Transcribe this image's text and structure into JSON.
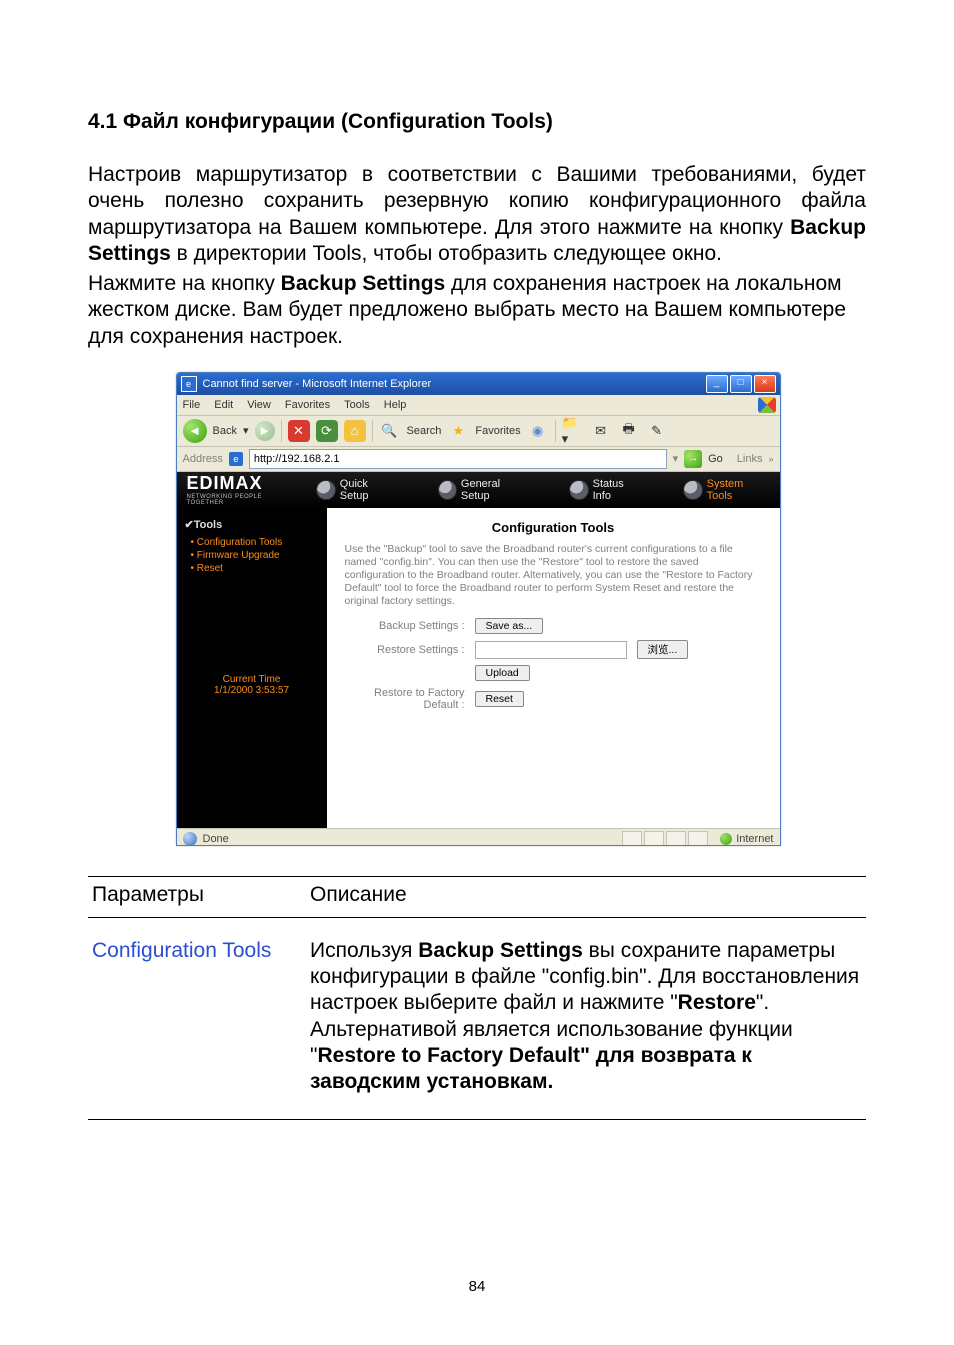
{
  "heading": "4.1 Файл конфигурации (Configuration Tools)",
  "para1_a": "Настроив маршрутизатор в соответствии с Вашими требованиями, будет очень полезно сохранить резервную копию конфигурационного файла маршрутизатора на Вашем компьютере. Для этого нажмите на кнопку ",
  "para1_b": "Backup Settings",
  "para1_c": " в директории Tools, чтобы отобразить следующее окно.",
  "para2_a": "Нажмите на кнопку ",
  "para2_b": "Backup Settings",
  "para2_c": " для сохранения настроек на локальном жестком диске. Вам будет предложено выбрать место на Вашем компьютере для сохранения настроек.",
  "browser": {
    "title": "Cannot find server - Microsoft Internet Explorer",
    "menu": {
      "file": "File",
      "edit": "Edit",
      "view": "View",
      "favorites": "Favorites",
      "tools": "Tools",
      "help": "Help"
    },
    "toolbar": {
      "back": "Back",
      "search": "Search",
      "favorites": "Favorites"
    },
    "addr_label": "Address",
    "addr_value": "http://192.168.2.1",
    "go_label": "Go",
    "links_label": "Links",
    "status_done": "Done",
    "status_zone": "Internet"
  },
  "router": {
    "brand": "EDIMAX",
    "brand_sub": "NETWORKING PEOPLE TOGETHER",
    "nav": {
      "quick": "Quick Setup",
      "general": "General Setup",
      "status": "Status Info",
      "system": "System Tools"
    },
    "side": {
      "section": "✔Tools",
      "items": [
        "Configuration Tools",
        "Firmware Upgrade",
        "Reset"
      ],
      "ct_label": "Current Time",
      "ct_value": "1/1/2000 3:53:57"
    },
    "page_title": "Configuration Tools",
    "blurb": "Use the \"Backup\" tool to save the Broadband router's current configurations to a file named \"config.bin\". You can then use the \"Restore\" tool to restore the saved configuration to the Broadband router. Alternatively, you can use the \"Restore to Factory Default\" tool to force the Broadband router to perform System Reset and restore the original factory settings.",
    "rows": {
      "backup_lbl": "Backup Settings :",
      "backup_btn": "Save as...",
      "restore_lbl": "Restore Settings :",
      "restore_btn": "Upload",
      "browse_btn": "浏览...",
      "reset_lbl": "Restore to Factory Default :",
      "reset_btn": "Reset"
    }
  },
  "table": {
    "h1": "Параметры",
    "h2": "Описание",
    "row1_name": "Configuration Tools",
    "row1_a": "Используя ",
    "row1_b": "Backup Settings",
    "row1_c": " вы сохраните параметры конфигурации в файле \"config.bin\". Для восстановления настроек выберите файл и нажмите \"",
    "row1_d": "Restore",
    "row1_e": "\". Альтернативой является использование функции \"",
    "row1_f": "Restore to Factory Default\" для возврата к заводским установкам."
  },
  "page_number": "84"
}
